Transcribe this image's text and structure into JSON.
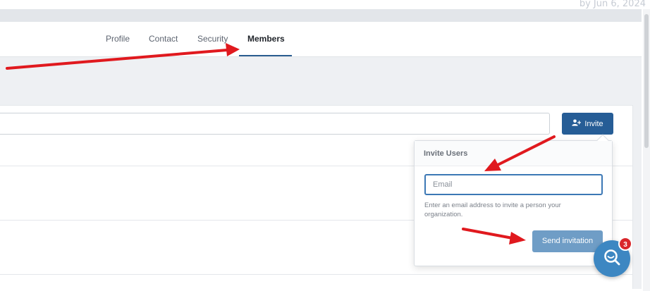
{
  "watermark": "by Jun 6, 2024",
  "tabs": [
    {
      "label": "Profile"
    },
    {
      "label": "Contact"
    },
    {
      "label": "Security"
    },
    {
      "label": "Members",
      "active": true
    }
  ],
  "invite_button": {
    "label": "Invite",
    "icon": "add-user-icon"
  },
  "invite_popover": {
    "title": "Invite Users",
    "email_placeholder": "Email",
    "help_text": "Enter an email address to invite a person your organization.",
    "send_label": "Send invitation"
  },
  "chat": {
    "badge_count": "3",
    "icon": "search-chat-icon"
  },
  "colors": {
    "primary": "#265d96",
    "send_button": "#6f9dc6",
    "annotation_arrow": "#e0191e",
    "chat_launcher": "#3d87c2",
    "badge": "#d9262a"
  }
}
